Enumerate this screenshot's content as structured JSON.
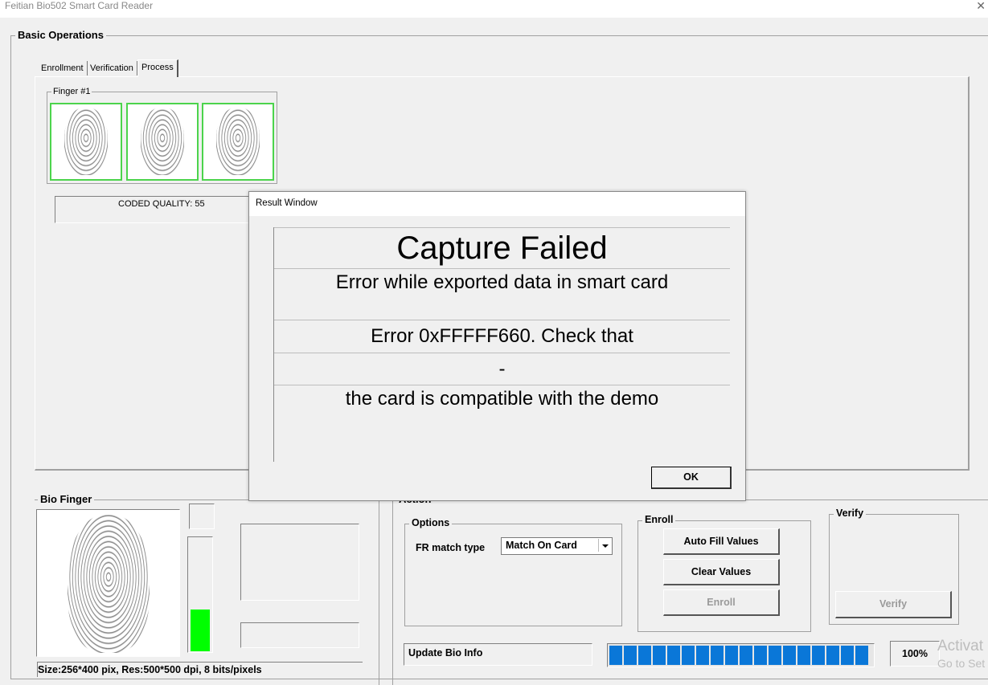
{
  "window": {
    "title": "Feitian Bio502 Smart Card Reader",
    "close": "✕"
  },
  "basic_ops": {
    "label": "Basic Operations",
    "tabs": [
      "Enrollment",
      "Verification",
      "Process"
    ],
    "finger_group": "Finger #1",
    "coded_quality": "CODED QUALITY: 55"
  },
  "dialog": {
    "title": "Result Window",
    "headline": "Capture Failed",
    "lines": [
      "Error while exported data in smart card",
      "Error 0xFFFFF660. Check that",
      "-",
      "the card is compatible with the demo"
    ],
    "ok": "OK"
  },
  "bio_finger": {
    "label": "Bio Finger",
    "size_info": "Size:256*400 pix, Res:500*500 dpi, 8 bits/pixels"
  },
  "action": {
    "label": "Action",
    "options_label": "Options",
    "fr_match_label": "FR match type",
    "fr_match_value": "Match On Card",
    "enroll_label": "Enroll",
    "auto_fill": "Auto Fill Values",
    "clear_values": "Clear Values",
    "enroll_btn": "Enroll",
    "verify_label": "Verify",
    "verify_btn": "Verify",
    "status": "Update Bio Info",
    "progress": "100%"
  },
  "watermark": {
    "line1": "Activat",
    "line2": "Go to Set"
  },
  "colors": {
    "progress": "#0a77d8",
    "level": "#00ff00",
    "thumb_border": "#4cd44c"
  }
}
